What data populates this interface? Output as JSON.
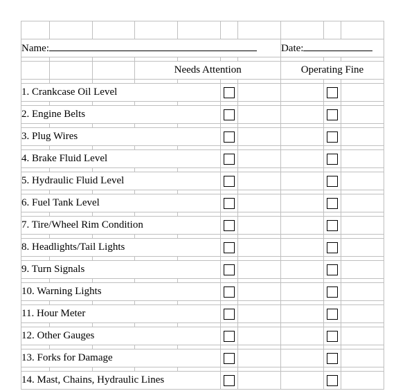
{
  "form": {
    "name_label": "Name:",
    "date_label": "Date:"
  },
  "columns": {
    "needs_attention": "Needs Attention",
    "operating_fine": "Operating Fine"
  },
  "items": [
    {
      "num": "1.",
      "label": "Crankcase Oil Level"
    },
    {
      "num": "2.",
      "label": "Engine Belts"
    },
    {
      "num": "3.",
      "label": "Plug Wires"
    },
    {
      "num": "4.",
      "label": "Brake Fluid Level"
    },
    {
      "num": "5.",
      "label": "Hydraulic Fluid Level"
    },
    {
      "num": "6.",
      "label": "Fuel Tank Level"
    },
    {
      "num": "7.",
      "label": "Tire/Wheel Rim Condition"
    },
    {
      "num": "8.",
      "label": "Headlights/Tail Lights"
    },
    {
      "num": "9.",
      "label": "Turn Signals"
    },
    {
      "num": "10.",
      "label": "Warning Lights"
    },
    {
      "num": "11.",
      "label": "Hour Meter"
    },
    {
      "num": "12.",
      "label": "Other Gauges"
    },
    {
      "num": "13.",
      "label": "Forks for Damage"
    },
    {
      "num": "14.",
      "label": "Mast, Chains, Hydraulic Lines"
    }
  ]
}
